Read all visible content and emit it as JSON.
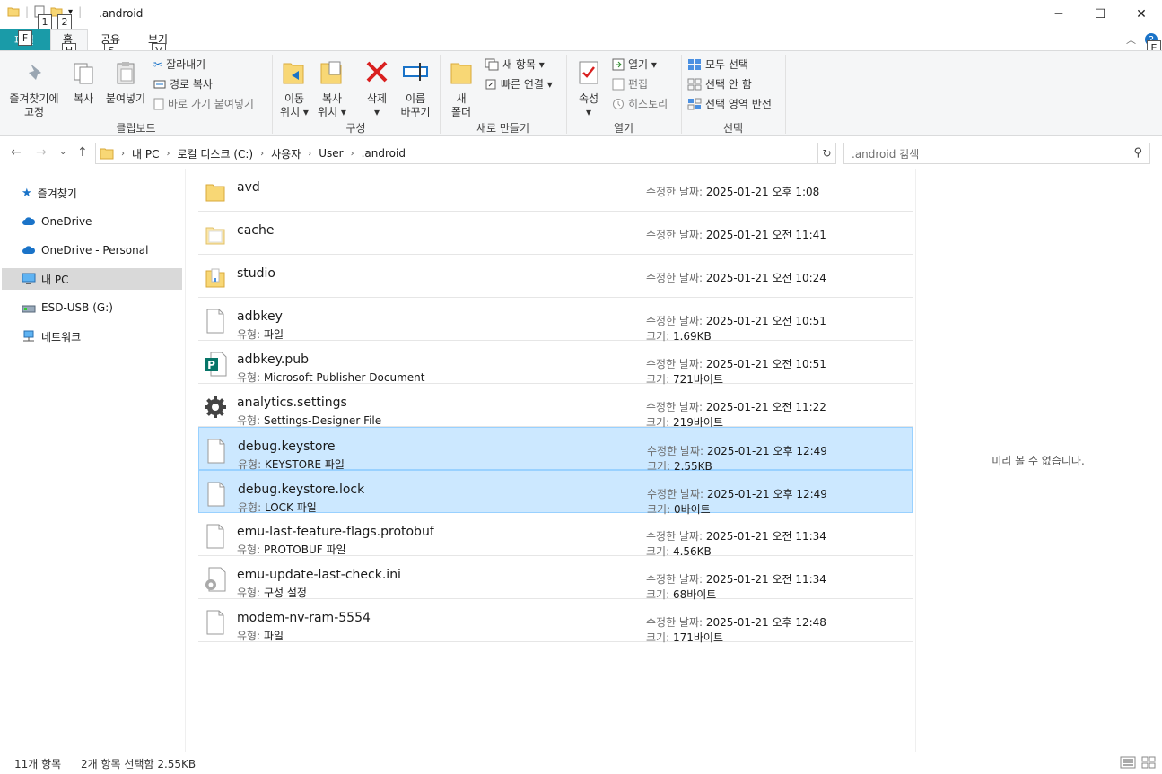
{
  "window": {
    "title": ".android",
    "controls": {
      "minimize": "─",
      "maximize": "☐",
      "close": "✕"
    }
  },
  "qat_keytips": [
    "1",
    "2"
  ],
  "tabs": {
    "file": "파일",
    "file_keytip": "F",
    "items": [
      {
        "label": "홈",
        "keytip": "H"
      },
      {
        "label": "공유",
        "keytip": "S"
      },
      {
        "label": "보기",
        "keytip": "V"
      }
    ],
    "help_keytip": "E"
  },
  "ribbon": {
    "clipboard": {
      "label": "클립보드",
      "pin": "즐겨찾기에\n고정",
      "copy": "복사",
      "paste": "붙여넣기",
      "cut": "잘라내기",
      "copy_path": "경로 복사",
      "paste_shortcut": "바로 가기 붙여넣기"
    },
    "organize": {
      "label": "구성",
      "move_to": "이동\n위치 ▾",
      "copy_to": "복사\n위치 ▾",
      "delete": "삭제\n▾",
      "rename": "이름\n바꾸기"
    },
    "new": {
      "label": "새로 만들기",
      "new_folder": "새\n폴더",
      "new_item": "새 항목 ▾",
      "easy_access": "빠른 연결 ▾"
    },
    "open": {
      "label": "열기",
      "properties": "속성\n▾",
      "open": "열기 ▾",
      "edit": "편집",
      "history": "히스토리"
    },
    "select": {
      "label": "선택",
      "select_all": "모두 선택",
      "select_none": "선택 안 함",
      "invert": "선택 영역 반전"
    }
  },
  "address": {
    "crumbs": [
      "내 PC",
      "로컬 디스크 (C:)",
      "사용자",
      "User",
      ".android"
    ],
    "search_placeholder": ".android 검색"
  },
  "nav": [
    {
      "label": "즐겨찾기",
      "icon": "star-icon"
    },
    {
      "label": "OneDrive",
      "icon": "cloud-icon"
    },
    {
      "label": "OneDrive - Personal",
      "icon": "cloud-icon"
    },
    {
      "label": "내 PC",
      "icon": "computer-icon",
      "selected": true
    },
    {
      "label": "ESD-USB (G:)",
      "icon": "usb-drive-icon"
    },
    {
      "label": "네트워크",
      "icon": "network-icon"
    }
  ],
  "labels": {
    "modified": "수정한 날짜:",
    "type": "유형:",
    "size": "크기:"
  },
  "files": [
    {
      "name": "avd",
      "kind": "folder",
      "modified": "2025-01-21 오후 1:08"
    },
    {
      "name": "cache",
      "kind": "folder-light",
      "modified": "2025-01-21 오전 11:41"
    },
    {
      "name": "studio",
      "kind": "folder-doc",
      "modified": "2025-01-21 오전 10:24"
    },
    {
      "name": "adbkey",
      "kind": "file",
      "type": "파일",
      "modified": "2025-01-21 오전 10:51",
      "size": "1.69KB"
    },
    {
      "name": "adbkey.pub",
      "kind": "publisher",
      "type": "Microsoft Publisher Document",
      "modified": "2025-01-21 오전 10:51",
      "size": "721바이트"
    },
    {
      "name": "analytics.settings",
      "kind": "settings",
      "type": "Settings-Designer File",
      "modified": "2025-01-21 오전 11:22",
      "size": "219바이트"
    },
    {
      "name": "debug.keystore",
      "kind": "file",
      "type": "KEYSTORE 파일",
      "modified": "2025-01-21 오후 12:49",
      "size": "2.55KB",
      "selected": true
    },
    {
      "name": "debug.keystore.lock",
      "kind": "file",
      "type": "LOCK 파일",
      "modified": "2025-01-21 오후 12:49",
      "size": "0바이트",
      "selected": true
    },
    {
      "name": "emu-last-feature-flags.protobuf",
      "kind": "file",
      "type": "PROTOBUF 파일",
      "modified": "2025-01-21 오전 11:34",
      "size": "4.56KB"
    },
    {
      "name": "emu-update-last-check.ini",
      "kind": "ini",
      "type": "구성 설정",
      "modified": "2025-01-21 오전 11:34",
      "size": "68바이트"
    },
    {
      "name": "modem-nv-ram-5554",
      "kind": "file",
      "type": "파일",
      "modified": "2025-01-21 오후 12:48",
      "size": "171바이트"
    }
  ],
  "preview": "미리 볼 수 없습니다.",
  "status": {
    "count": "11개 항목",
    "selection": "2개 항목 선택함 2.55KB"
  },
  "colors": {
    "accent": "#1a9ba8",
    "selection": "#cce8ff",
    "selection_border": "#99d1ff",
    "folder": "#f8d775"
  }
}
